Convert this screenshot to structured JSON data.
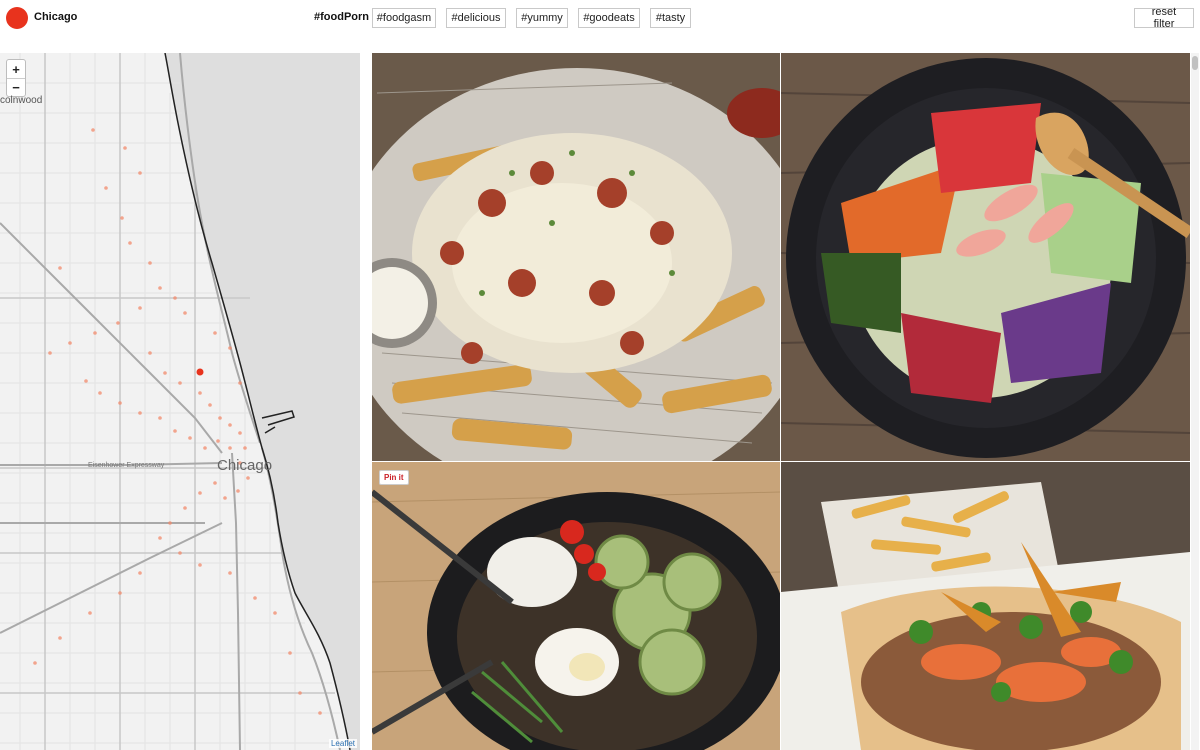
{
  "header": {
    "city": "Chicago",
    "active_tag": "#foodPorn",
    "tags": [
      "#foodgasm",
      "#delicious",
      "#yummy",
      "#goodeats",
      "#tasty"
    ],
    "reset_label": "reset filter",
    "accent_color": "#e8331d"
  },
  "map": {
    "zoom_in": "+",
    "zoom_out": "−",
    "labels": {
      "neighborhood": "colnwood",
      "city": "Chicago",
      "expressway": "Eisenhower Expressway"
    },
    "attribution": "Leaflet",
    "point_color": "#f28a6b",
    "selected_color": "#e8331d"
  },
  "photos": {
    "pin_label": "Pin it",
    "items": [
      {
        "subject": "loaded fries"
      },
      {
        "subject": "poke bowl"
      },
      {
        "subject": "rice bowl"
      },
      {
        "subject": "taco and fries"
      }
    ]
  }
}
